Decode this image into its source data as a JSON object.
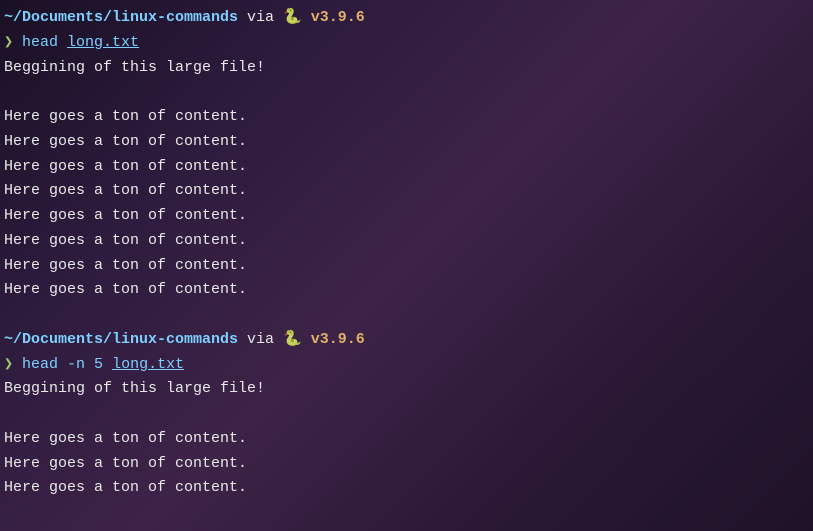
{
  "block1": {
    "path": "~/Documents/linux-commands",
    "via": " via ",
    "snake": "🐍 ",
    "version": "v3.9.6",
    "arrow": "❯",
    "command": " head ",
    "filename": "long.txt",
    "output_lines": [
      "Beggining of this large file!",
      "",
      "Here goes a ton of content.",
      "Here goes a ton of content.",
      "Here goes a ton of content.",
      "Here goes a ton of content.",
      "Here goes a ton of content.",
      "Here goes a ton of content.",
      "Here goes a ton of content.",
      "Here goes a ton of content."
    ]
  },
  "block2": {
    "path": "~/Documents/linux-commands",
    "via": " via ",
    "snake": "🐍 ",
    "version": "v3.9.6",
    "arrow": "❯",
    "command": " head -n 5 ",
    "filename": "long.txt",
    "output_lines": [
      "Beggining of this large file!",
      "",
      "Here goes a ton of content.",
      "Here goes a ton of content.",
      "Here goes a ton of content."
    ]
  }
}
